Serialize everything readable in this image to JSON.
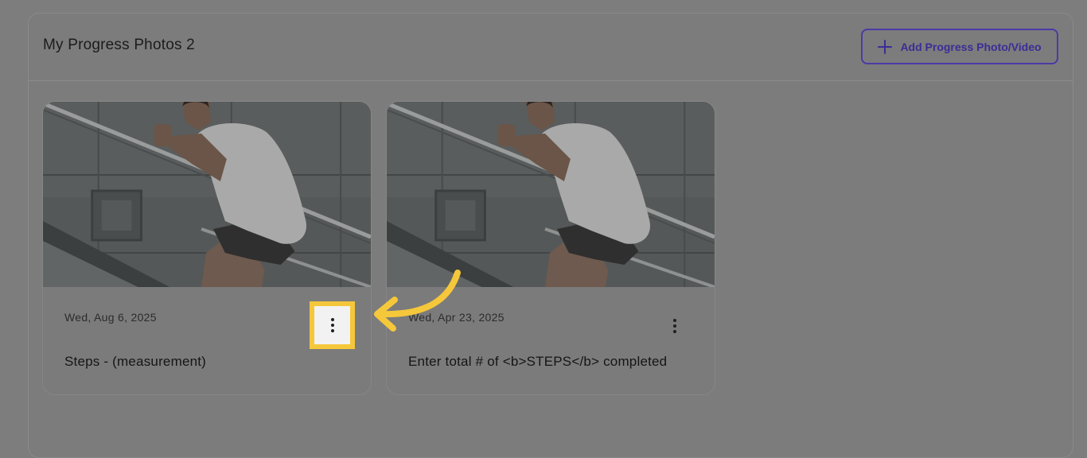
{
  "panel": {
    "title": "My Progress Photos 2",
    "add_button_label": "Add Progress Photo/Video"
  },
  "cards": [
    {
      "date": "Wed, Aug 6, 2025",
      "caption": "Steps - (measurement)"
    },
    {
      "date": "Wed, Apr 23, 2025",
      "caption": "Enter total # of <b>STEPS</b> completed"
    }
  ],
  "icons": {
    "add": "plus-icon",
    "menu": "more-vertical-icon",
    "pointer": "curved-arrow-icon"
  },
  "colors": {
    "accent": "#3a2d96",
    "highlight": "#f5c73b",
    "overlay": "#7d7d7d"
  }
}
